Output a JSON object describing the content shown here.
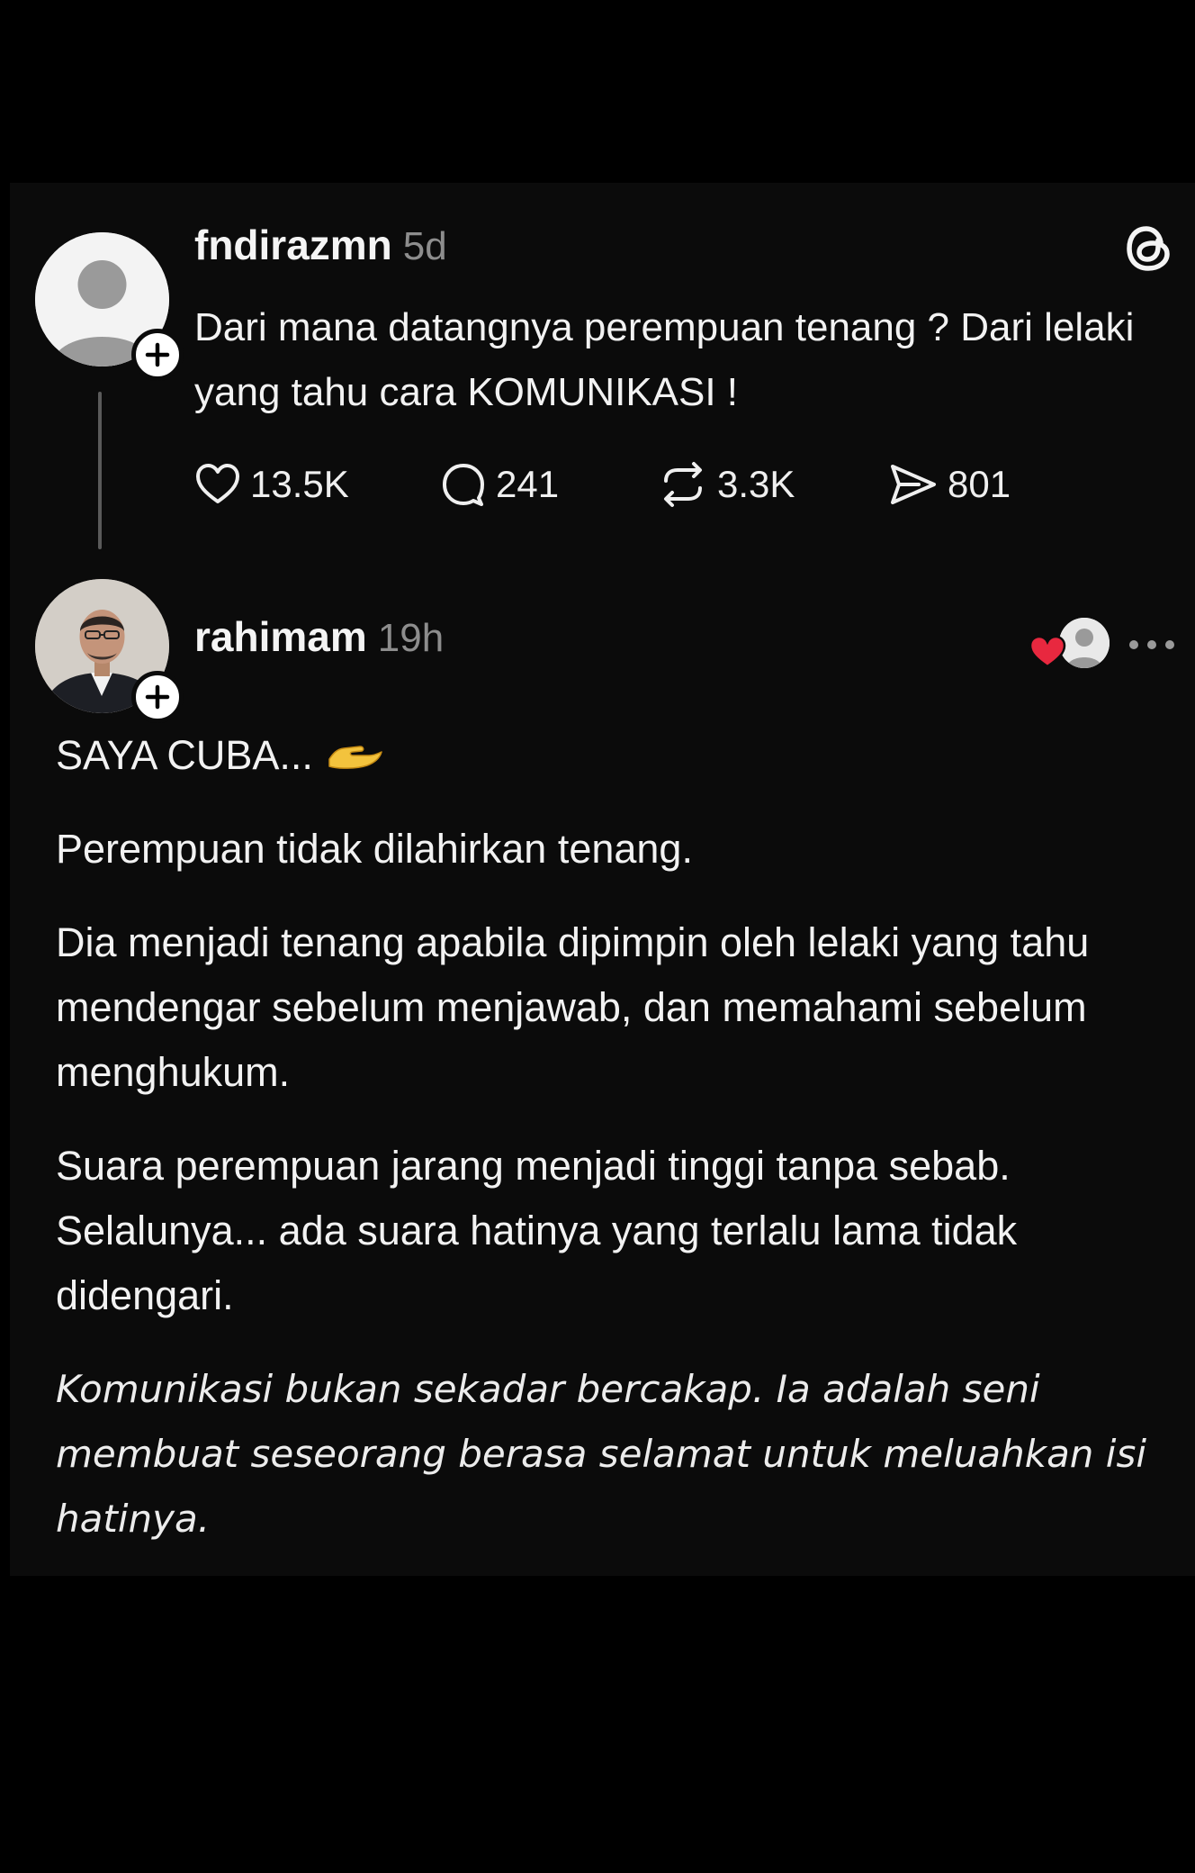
{
  "post": {
    "username": "fndirazmn",
    "time": "5d",
    "text": "Dari mana datangnya perempuan tenang ? Dari lelaki yang tahu cara KOMUNIKASI !",
    "stats": {
      "likes": "13.5K",
      "comments": "241",
      "reposts": "3.3K",
      "shares": "801"
    }
  },
  "reply": {
    "username": "rahimam",
    "time": "19h",
    "paragraphs": {
      "p1": "SAYA CUBA...",
      "p2": "Perempuan tidak dilahirkan tenang.",
      "p3": "Dia menjadi tenang apabila dipimpin oleh lelaki yang tahu mendengar sebelum menjawab, dan memahami sebelum menghukum.",
      "p4": "Suara perempuan jarang menjadi tinggi tanpa sebab.",
      "p5": "Selalunya... ada suara hatinya yang terlalu lama tidak didengari.",
      "p6": "Komunikasi bukan sekadar bercakap. Ia adalah seni membuat seseorang berasa selamat untuk meluahkan isi hatinya."
    }
  },
  "icons": {
    "like": "heart-icon",
    "comment": "comment-icon",
    "repost": "repost-icon",
    "share": "send-icon",
    "app": "threads-logo-icon",
    "more": "more-icon"
  },
  "colors": {
    "background": "#000000",
    "card": "#0b0b0b",
    "text": "#f2f2f2",
    "muted": "#8d8d8d",
    "heart": "#e8283f"
  }
}
